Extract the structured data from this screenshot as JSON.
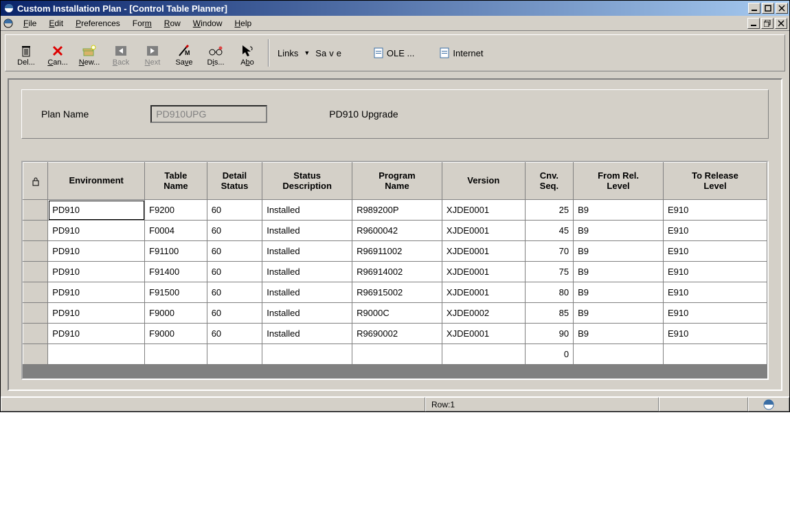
{
  "title": "Custom Installation Plan - [Control Table Planner]",
  "menus": {
    "file": {
      "label": "File",
      "ul": "F"
    },
    "edit": {
      "label": "Edit",
      "ul": "E"
    },
    "prefs": {
      "label": "Preferences",
      "ul": "P"
    },
    "form": {
      "label": "Form",
      "ul": "m"
    },
    "row": {
      "label": "Row",
      "ul": "R"
    },
    "window": {
      "label": "Window",
      "ul": "W"
    },
    "help": {
      "label": "Help",
      "ul": "H"
    }
  },
  "toolbar": {
    "del": {
      "label": "Del...",
      "ul": ""
    },
    "can": {
      "label": "Can...",
      "ul": "C"
    },
    "new": {
      "label": "New...",
      "ul": "N"
    },
    "back": {
      "label": "Back",
      "ul": "B"
    },
    "next": {
      "label": "Next",
      "ul": "N"
    },
    "save": {
      "label": "Save",
      "ul": "v"
    },
    "dis": {
      "label": "Dis...",
      "ul": "i"
    },
    "abo": {
      "label": "Abo",
      "ul": "b"
    }
  },
  "links": {
    "label": "Links",
    "save": {
      "label": "Save",
      "ul": "v"
    },
    "ole": "OLE ...",
    "internet": "Internet"
  },
  "plan": {
    "label": "Plan Name",
    "value": "PD910UPG",
    "desc": "PD910 Upgrade"
  },
  "columns": {
    "env": "Environment",
    "table": "Table\nName",
    "detail": "Detail\nStatus",
    "statdesc": "Status\nDescription",
    "program": "Program\nName",
    "version": "Version",
    "cnvseq": "Cnv.\nSeq.",
    "fromrel": "From Rel.\nLevel",
    "torel": "To Release\nLevel"
  },
  "rows": [
    {
      "env": "PD910",
      "table": "F9200",
      "detail": "60",
      "statdesc": "Installed",
      "program": "R989200P",
      "version": "XJDE0001",
      "cnvseq": "25",
      "fromrel": "B9",
      "torel": "E910"
    },
    {
      "env": "PD910",
      "table": "F0004",
      "detail": "60",
      "statdesc": "Installed",
      "program": "R9600042",
      "version": "XJDE0001",
      "cnvseq": "45",
      "fromrel": "B9",
      "torel": "E910"
    },
    {
      "env": "PD910",
      "table": "F91100",
      "detail": "60",
      "statdesc": "Installed",
      "program": "R96911002",
      "version": "XJDE0001",
      "cnvseq": "70",
      "fromrel": "B9",
      "torel": "E910"
    },
    {
      "env": "PD910",
      "table": "F91400",
      "detail": "60",
      "statdesc": "Installed",
      "program": "R96914002",
      "version": "XJDE0001",
      "cnvseq": "75",
      "fromrel": "B9",
      "torel": "E910"
    },
    {
      "env": "PD910",
      "table": "F91500",
      "detail": "60",
      "statdesc": "Installed",
      "program": "R96915002",
      "version": "XJDE0001",
      "cnvseq": "80",
      "fromrel": "B9",
      "torel": "E910"
    },
    {
      "env": "PD910",
      "table": "F9000",
      "detail": "60",
      "statdesc": "Installed",
      "program": "R9000C",
      "version": "XJDE0002",
      "cnvseq": "85",
      "fromrel": "B9",
      "torel": "E910"
    },
    {
      "env": "PD910",
      "table": "F9000",
      "detail": "60",
      "statdesc": "Installed",
      "program": "R9690002",
      "version": "XJDE0001",
      "cnvseq": "90",
      "fromrel": "B9",
      "torel": "E910"
    },
    {
      "env": "",
      "table": "",
      "detail": "",
      "statdesc": "",
      "program": "",
      "version": "",
      "cnvseq": "0",
      "fromrel": "",
      "torel": ""
    }
  ],
  "status": {
    "row": "Row:1"
  }
}
